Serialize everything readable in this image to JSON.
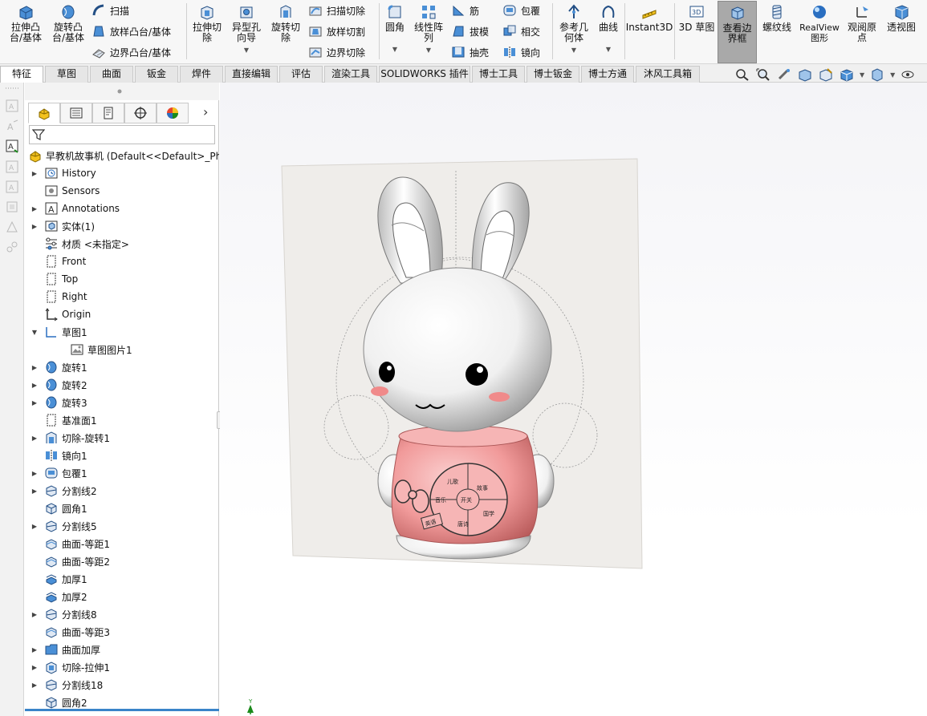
{
  "ribbon": {
    "extrude_boss": "拉伸凸\n台/基体",
    "revolve_boss": "旋转凸\n台/基体",
    "sweep": "扫描",
    "loft_boss": "放样凸台/基体",
    "boundary_boss": "边界凸台/基体",
    "extrude_cut": "拉伸切\n除",
    "hole_wizard": "异型孔\n向导",
    "revolve_cut": "旋转切\n除",
    "swept_cut": "扫描切除",
    "lofted_cut": "放样切割",
    "boundary_cut": "边界切除",
    "fillet": "圆角",
    "linear_pattern": "线性阵\n列",
    "rib": "筋",
    "draft": "拔模",
    "shell": "抽壳",
    "wrap": "包覆",
    "intersect": "相交",
    "mirror": "镜向",
    "ref_geometry": "参考几\n何体",
    "curves": "曲线",
    "instant3d": "Instant3D",
    "sketch3d": "3D 草图",
    "bounding_box": "查看边\n界框",
    "thread": "螺纹线",
    "realview": "RealView\n图形",
    "view_origins": "观阅原\n点",
    "perspective": "透视图"
  },
  "tabs": [
    {
      "label": "特征"
    },
    {
      "label": "草图"
    },
    {
      "label": "曲面"
    },
    {
      "label": "钣金"
    },
    {
      "label": "焊件"
    },
    {
      "label": "直接编辑"
    },
    {
      "label": "评估"
    },
    {
      "label": "渲染工具"
    },
    {
      "label": "SOLIDWORKS 插件"
    },
    {
      "label": "博士工具"
    },
    {
      "label": "博士钣金"
    },
    {
      "label": "博士方通"
    },
    {
      "label": "沐风工具箱"
    }
  ],
  "tree": {
    "root": "早教机故事机  (Default<<Default>_Ph",
    "items": [
      {
        "label": "History",
        "icon": "history-icon",
        "expand": true
      },
      {
        "label": "Sensors",
        "icon": "sensors-icon",
        "expand": false
      },
      {
        "label": "Annotations",
        "icon": "annotations-icon",
        "expand": true
      },
      {
        "label": "实体(1)",
        "icon": "solid-bodies-icon",
        "expand": true
      },
      {
        "label": "材质 <未指定>",
        "icon": "material-icon",
        "expand": false
      },
      {
        "label": "Front",
        "icon": "plane-icon",
        "expand": false
      },
      {
        "label": "Top",
        "icon": "plane-icon",
        "expand": false
      },
      {
        "label": "Right",
        "icon": "plane-icon",
        "expand": false
      },
      {
        "label": "Origin",
        "icon": "origin-icon",
        "expand": false
      },
      {
        "label": "草图1",
        "icon": "sketch-icon",
        "expand": "open"
      },
      {
        "label": "草图图片1",
        "icon": "sketch-picture-icon",
        "expand": false,
        "indent": true
      },
      {
        "label": "旋转1",
        "icon": "revolve-icon",
        "expand": true
      },
      {
        "label": "旋转2",
        "icon": "revolve-icon",
        "expand": true
      },
      {
        "label": "旋转3",
        "icon": "revolve-icon",
        "expand": true
      },
      {
        "label": "基准面1",
        "icon": "plane-icon",
        "expand": false
      },
      {
        "label": "切除-旋转1",
        "icon": "revolve-cut-icon",
        "expand": true
      },
      {
        "label": "镜向1",
        "icon": "mirror-icon",
        "expand": false
      },
      {
        "label": "包覆1",
        "icon": "wrap-icon",
        "expand": true
      },
      {
        "label": "分割线2",
        "icon": "split-line-icon",
        "expand": true
      },
      {
        "label": "圆角1",
        "icon": "fillet-icon",
        "expand": false
      },
      {
        "label": "分割线5",
        "icon": "split-line-icon",
        "expand": true
      },
      {
        "label": "曲面-等距1",
        "icon": "offset-surface-icon",
        "expand": false
      },
      {
        "label": "曲面-等距2",
        "icon": "offset-surface-icon",
        "expand": false
      },
      {
        "label": "加厚1",
        "icon": "thicken-icon",
        "expand": false
      },
      {
        "label": "加厚2",
        "icon": "thicken-icon",
        "expand": false
      },
      {
        "label": "分割线8",
        "icon": "split-line-icon",
        "expand": true
      },
      {
        "label": "曲面-等距3",
        "icon": "offset-surface-icon",
        "expand": false
      },
      {
        "label": "曲面加厚",
        "icon": "folder-icon",
        "expand": true
      },
      {
        "label": "切除-拉伸1",
        "icon": "extrude-cut-icon",
        "expand": true
      },
      {
        "label": "分割线18",
        "icon": "split-line-icon",
        "expand": true
      },
      {
        "label": "圆角2",
        "icon": "fillet-icon",
        "expand": false
      }
    ]
  },
  "model": {
    "label_left": "儿歌",
    "label_right": "故事",
    "label_center": "开关",
    "label_side_left": "音乐",
    "label_side_right": "国学",
    "label_bottom": "唐诗",
    "label_tag": "英语",
    "triad_y": "Y"
  },
  "colors": {
    "active_tab": "#ffffff",
    "body_pink": "#f19a9a",
    "selection_bar": "#3a84c9"
  }
}
